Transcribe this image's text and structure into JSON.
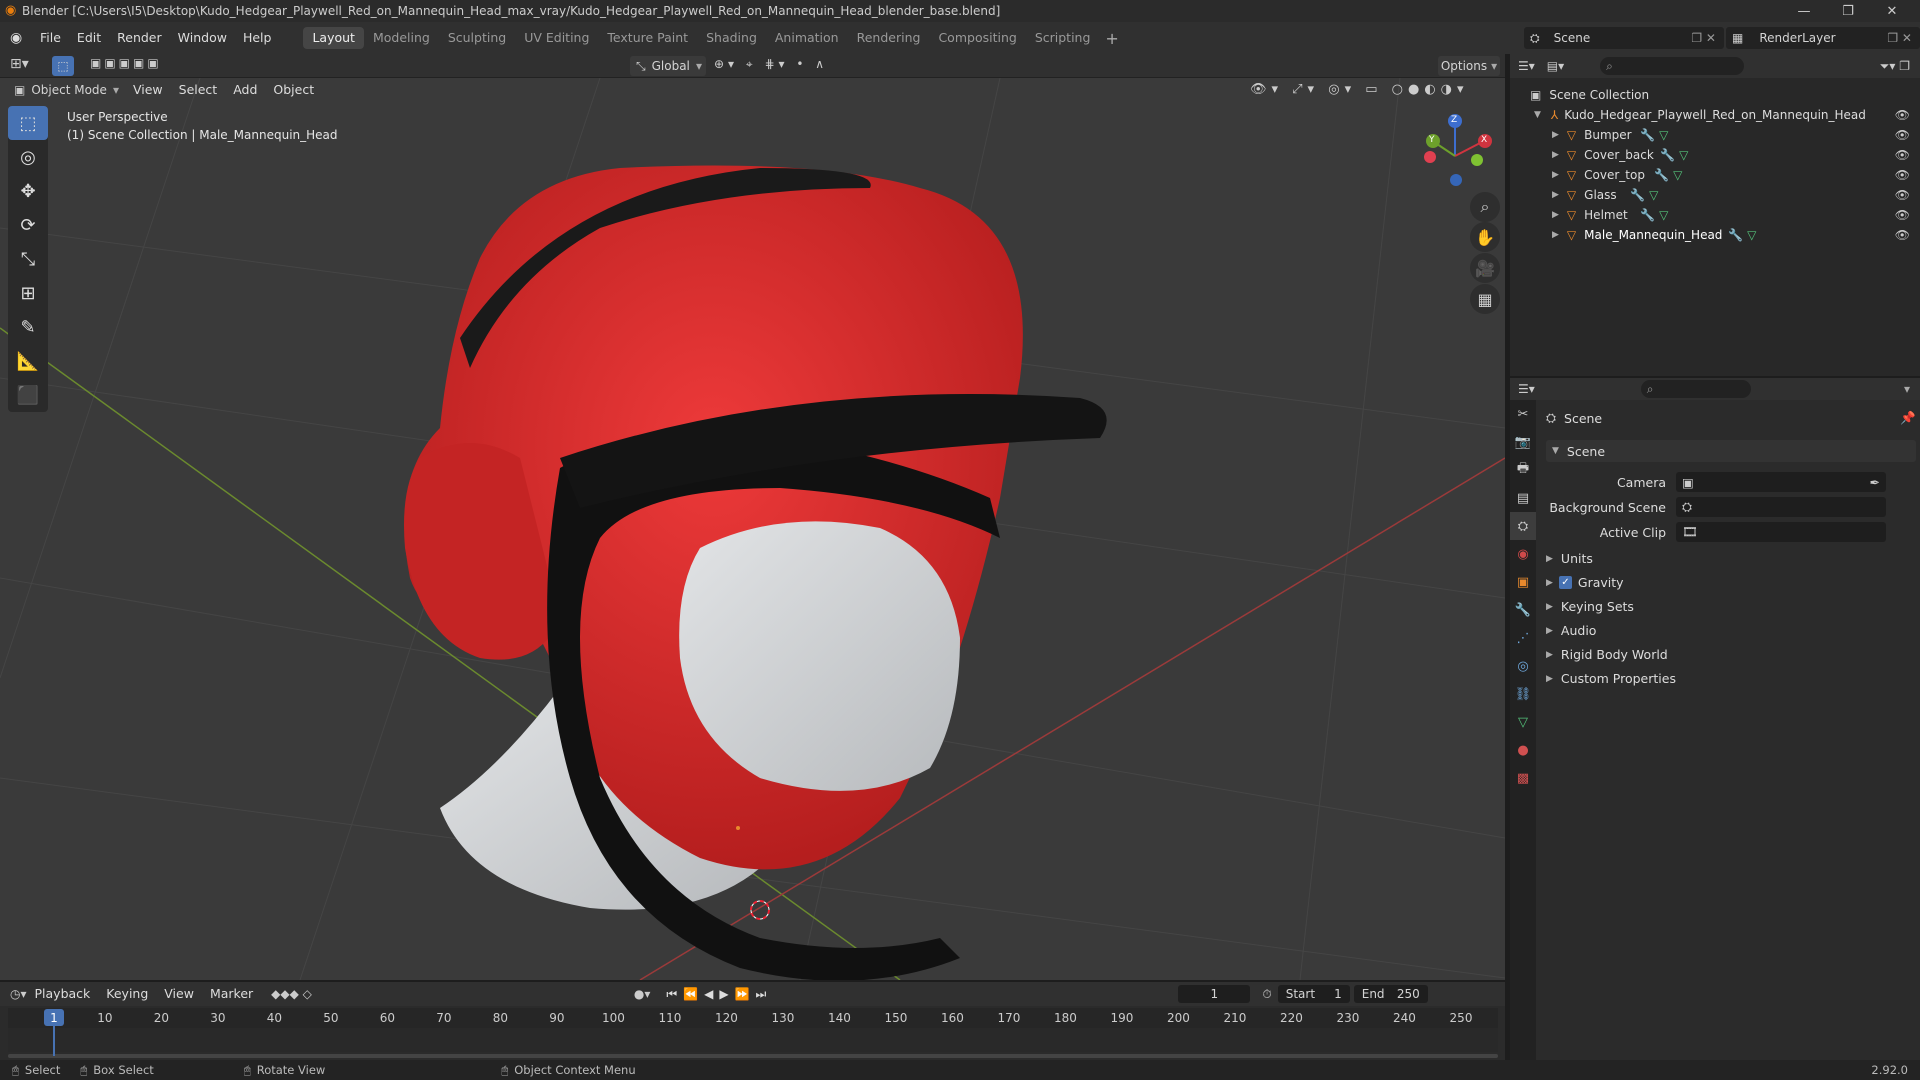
{
  "window": {
    "title": "Blender [C:\\Users\\I5\\Desktop\\Kudo_Hedgear_Playwell_Red_on_Mannequin_Head_max_vray/Kudo_Hedgear_Playwell_Red_on_Mannequin_Head_blender_base.blend]"
  },
  "menu": [
    "File",
    "Edit",
    "Render",
    "Window",
    "Help"
  ],
  "workspaces": [
    "Layout",
    "Modeling",
    "Sculpting",
    "UV Editing",
    "Texture Paint",
    "Shading",
    "Animation",
    "Rendering",
    "Compositing",
    "Scripting"
  ],
  "active_workspace": "Layout",
  "scene_selector": {
    "scene": "Scene",
    "render_layer": "RenderLayer"
  },
  "viewport_header": {
    "mode": "Object Mode",
    "menus": [
      "View",
      "Select",
      "Add",
      "Object"
    ],
    "transform_orientation": "Global",
    "options": "Options"
  },
  "viewport_info": {
    "line1": "User Perspective",
    "line2": "(1) Scene Collection | Male_Mannequin_Head"
  },
  "gizmo": {
    "x": "X",
    "y": "Y",
    "z": "Z"
  },
  "outliner": {
    "root": "Scene Collection",
    "collection": "Kudo_Hedgear_Playwell_Red_on_Mannequin_Head",
    "objects": [
      "Bumper",
      "Cover_back",
      "Cover_top",
      "Glass",
      "Helmet",
      "Male_Mannequin_Head"
    ]
  },
  "properties": {
    "header": "Scene",
    "panel": "Scene",
    "fields": [
      {
        "label": "Camera"
      },
      {
        "label": "Background Scene"
      },
      {
        "label": "Active Clip"
      }
    ],
    "sections": [
      "Units",
      "Gravity",
      "Keying Sets",
      "Audio",
      "Rigid Body World",
      "Custom Properties"
    ],
    "gravity_checked": true
  },
  "timeline": {
    "menus": [
      "Playback",
      "Keying",
      "View",
      "Marker"
    ],
    "current_frame": "1",
    "start_label": "Start",
    "start": "1",
    "end_label": "End",
    "end": "250",
    "ticks": [
      "1",
      "10",
      "20",
      "30",
      "40",
      "50",
      "60",
      "70",
      "80",
      "90",
      "100",
      "110",
      "120",
      "130",
      "140",
      "150",
      "160",
      "170",
      "180",
      "190",
      "200",
      "210",
      "220",
      "230",
      "240",
      "250"
    ]
  },
  "statusbar": {
    "select": "Select",
    "box_select": "Box Select",
    "rotate": "Rotate View",
    "context": "Object Context Menu",
    "version": "2.92.0"
  },
  "colors": {
    "accent": "#4772b3",
    "helmet_red": "#d42a2a",
    "orange": "#e8892d"
  }
}
